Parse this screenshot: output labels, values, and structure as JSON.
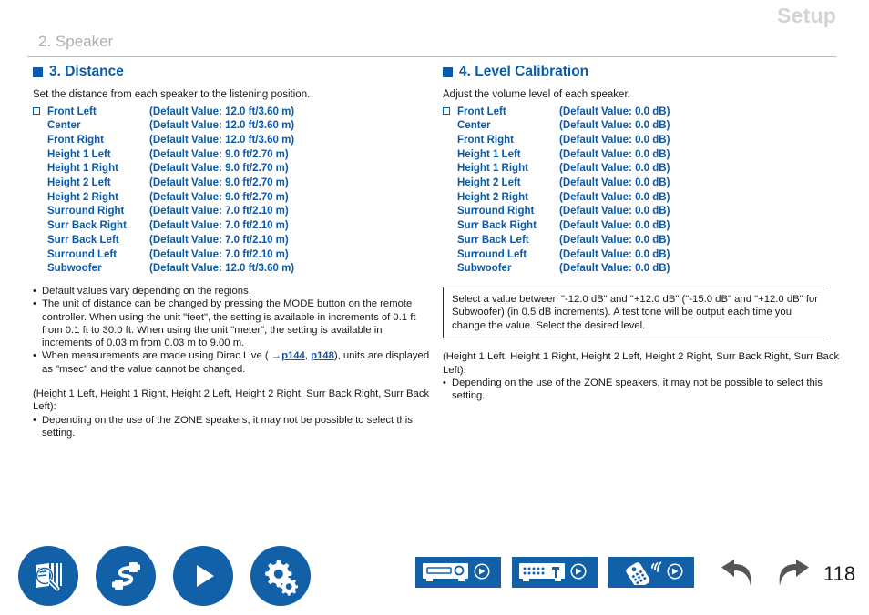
{
  "header": {
    "setup_title": "Setup",
    "chapter_title": "2. Speaker"
  },
  "left_section": {
    "heading": "3. Distance",
    "intro": "Set the distance from each speaker to the listening position.",
    "speakers": [
      {
        "name": "Front Left",
        "value": "(Default Value: 12.0 ft/3.60 m)",
        "checkbox": true
      },
      {
        "name": "Center",
        "value": "(Default Value: 12.0 ft/3.60 m)",
        "checkbox": false
      },
      {
        "name": "Front Right",
        "value": "(Default Value: 12.0 ft/3.60 m)",
        "checkbox": false
      },
      {
        "name": "Height 1 Left",
        "value": "(Default Value: 9.0 ft/2.70 m)",
        "checkbox": false
      },
      {
        "name": "Height 1 Right",
        "value": "(Default Value: 9.0 ft/2.70 m)",
        "checkbox": false
      },
      {
        "name": "Height 2 Left",
        "value": "(Default Value: 9.0 ft/2.70 m)",
        "checkbox": false
      },
      {
        "name": "Height 2 Right",
        "value": "(Default Value: 9.0 ft/2.70 m)",
        "checkbox": false
      },
      {
        "name": "Surround Right",
        "value": "(Default Value: 7.0 ft/2.10 m)",
        "checkbox": false
      },
      {
        "name": "Surr Back Right",
        "value": "(Default Value: 7.0 ft/2.10 m)",
        "checkbox": false
      },
      {
        "name": "Surr Back Left",
        "value": "(Default Value: 7.0 ft/2.10 m)",
        "checkbox": false
      },
      {
        "name": "Surround Left",
        "value": "(Default Value: 7.0 ft/2.10 m)",
        "checkbox": false
      },
      {
        "name": "Subwoofer",
        "value": "(Default Value: 12.0 ft/3.60 m)",
        "checkbox": false
      }
    ],
    "note1": "Default values vary depending on the regions.",
    "note2": "The unit of distance can be changed by pressing the MODE button on the remote controller. When using the unit \"feet\", the setting is available in increments of 0.1 ft from 0.1 ft to 30.0 ft. When using the unit \"meter\", the setting is available in increments of 0.03 m from 0.03 m to 9.00 m.",
    "note3_pre": "When measurements are made using Dirac Live ( ",
    "note3_arrow": "→",
    "note3_link1": "p144",
    "note3_mid": ", ",
    "note3_link2": "p148",
    "note3_post": "), units are displayed as \"msec\" and the value cannot be changed.",
    "zone_para": "(Height 1 Left, Height 1 Right, Height 2 Left, Height 2 Right, Surr Back Right, Surr Back Left):",
    "zone_note": "Depending on the use of the ZONE speakers, it may not be possible to select this setting."
  },
  "right_section": {
    "heading": "4. Level Calibration",
    "intro": "Adjust the volume level of each speaker.",
    "speakers": [
      {
        "name": "Front Left",
        "value": "(Default Value: 0.0 dB)",
        "checkbox": true
      },
      {
        "name": "Center",
        "value": "(Default Value: 0.0 dB)",
        "checkbox": false
      },
      {
        "name": "Front Right",
        "value": "(Default Value: 0.0 dB)",
        "checkbox": false
      },
      {
        "name": "Height 1 Left",
        "value": "(Default Value: 0.0 dB)",
        "checkbox": false
      },
      {
        "name": "Height 1 Right",
        "value": "(Default Value: 0.0 dB)",
        "checkbox": false
      },
      {
        "name": "Height 2 Left",
        "value": "(Default Value: 0.0 dB)",
        "checkbox": false
      },
      {
        "name": "Height 2 Right",
        "value": "(Default Value: 0.0 dB)",
        "checkbox": false
      },
      {
        "name": "Surround Right",
        "value": "(Default Value: 0.0 dB)",
        "checkbox": false
      },
      {
        "name": "Surr Back Right",
        "value": "(Default Value: 0.0 dB)",
        "checkbox": false
      },
      {
        "name": "Surr Back Left",
        "value": "(Default Value: 0.0 dB)",
        "checkbox": false
      },
      {
        "name": "Surround Left",
        "value": "(Default Value: 0.0 dB)",
        "checkbox": false
      },
      {
        "name": "Subwoofer",
        "value": "(Default Value: 0.0 dB)",
        "checkbox": false
      }
    ],
    "boxed_note": "Select a value between \"-12.0 dB\" and \"+12.0 dB\" (\"-15.0 dB\" and \"+12.0 dB\" for Subwoofer) (in 0.5 dB increments). A test tone will be output each time you change the value. Select the desired level.",
    "zone_para": "(Height 1 Left, Height 1 Right, Height 2 Left, Height 2 Right, Surr Back Right, Surr Back Left):",
    "zone_note": "Depending on the use of the ZONE speakers, it may not be possible to select this setting."
  },
  "footer": {
    "circle_icons": [
      "manual-search-icon",
      "connections-cable-icon",
      "playback-play-icon",
      "settings-gears-icon"
    ],
    "rect_icons": [
      "front-panel-icon",
      "rear-panel-icon",
      "remote-controller-icon"
    ],
    "nav_back": "back-arrow-icon",
    "nav_forward": "forward-arrow-icon",
    "page_number": "118"
  },
  "colors": {
    "brand_blue": "#0a5aa8",
    "icon_blue": "#1260a8",
    "link_blue": "#14539e",
    "header_gray": "#d3d3d3",
    "chapter_gray": "#b0b0b0",
    "nav_gray": "#555555"
  }
}
